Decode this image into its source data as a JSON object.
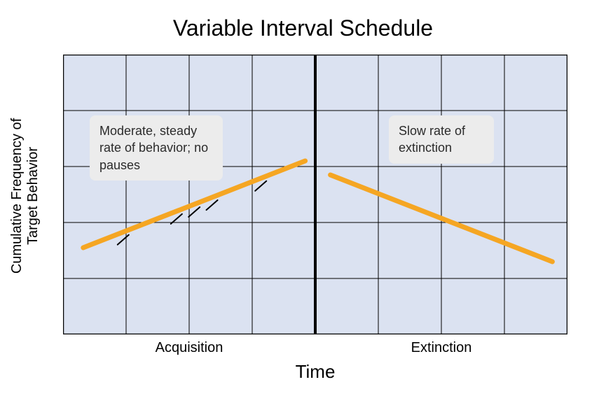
{
  "chart_data": {
    "type": "line",
    "title": "Variable Interval Schedule",
    "xlabel": "Time",
    "ylabel": "Cumulative Frequency of\nTarget Behavior",
    "phases": {
      "left": "Acquisition",
      "right": "Extinction"
    },
    "annotations": {
      "left": "Moderate, steady rate of behavior; no pauses",
      "right": "Slow rate of extinction"
    },
    "grid": {
      "cols": 8,
      "rows": 5
    },
    "plot_fill": "#dbe2f1",
    "line_color": "#f5a623",
    "series": [
      {
        "name": "acquisition-trend",
        "phase": "left",
        "x": [
          0.04,
          0.48
        ],
        "y": [
          0.31,
          0.62
        ],
        "comment": "steady moderate increase across Acquisition phase; x as fraction of full width, y as fraction of height from bottom"
      },
      {
        "name": "extinction-trend",
        "phase": "right",
        "x": [
          0.53,
          0.97
        ],
        "y": [
          0.57,
          0.26
        ],
        "comment": "slow decline across Extinction phase"
      }
    ],
    "ticks": [
      {
        "along": "acquisition-trend",
        "positions": [
          0.18,
          0.42,
          0.5,
          0.58,
          0.8
        ],
        "comment": "small hash marks along the acquisition line"
      }
    ]
  }
}
